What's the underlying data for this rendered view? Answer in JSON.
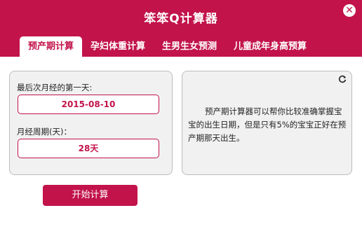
{
  "app": {
    "title": "笨笨Q计算器"
  },
  "tabs": [
    {
      "label": "预产期计算"
    },
    {
      "label": "孕妇体重计算"
    },
    {
      "label": "生男生女预测"
    },
    {
      "label": "儿童成年身高预算"
    }
  ],
  "form": {
    "last_period_label": "最后次月经的第一天:",
    "last_period_value": "2015-08-10",
    "cycle_label": "月经周期(天)：",
    "cycle_value": "28天",
    "start_button": "开始计算"
  },
  "info": {
    "text": "预产期计算器可以帮你比较准确掌握宝宝的出生日期，但是只有5%的宝宝正好在预产期那天出生。"
  },
  "colors": {
    "brand": "#c2134a"
  }
}
